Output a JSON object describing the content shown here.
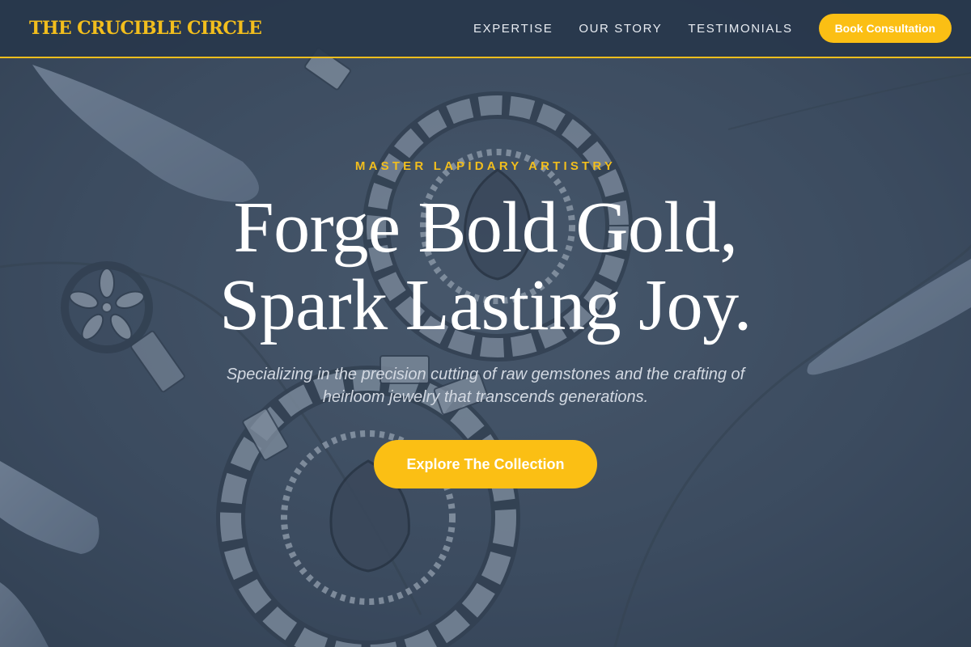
{
  "header": {
    "brand": "THE CRUCIBLE CIRCLE",
    "nav": [
      {
        "label": "EXPERTISE"
      },
      {
        "label": "OUR STORY"
      },
      {
        "label": "TESTIMONIALS"
      }
    ],
    "cta_label": "Book Consultation"
  },
  "hero": {
    "eyebrow": "MASTER LAPIDARY ARTISTRY",
    "headline_line1": "Forge Bold Gold,",
    "headline_line2": "Spark Lasting Joy.",
    "subtext": "Specializing in the precision cutting of raw gemstones and the crafting of heirloom jewelry that transcends generations.",
    "cta_label": "Explore The Collection",
    "background_subject": "jeweled-earring-photo"
  },
  "colors": {
    "accent": "#fbbf14",
    "brand_text": "#f2be1d",
    "nav_background": "#28374c",
    "overlay": "#3a4a5e",
    "headline": "#ffffff"
  }
}
